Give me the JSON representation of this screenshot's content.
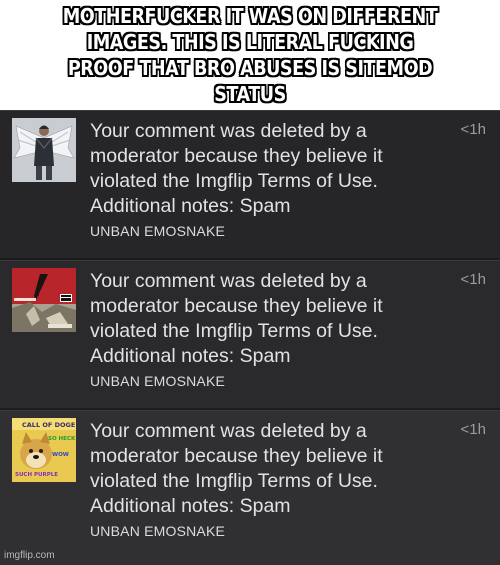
{
  "caption": "MOTHERFUCKER IT WAS ON DIFFERENT\nIMAGES. THIS IS LITERAL FUCKING\nPROOF THAT BRO ABUSES IS SITEMOD STATUS",
  "notifications": [
    {
      "message": "Your comment was deleted by a moderator because they believe it violated the Imgflip Terms of Use. Additional notes: Spam",
      "time": "<1h",
      "action": "UNBAN EMOSNAKE",
      "thumbnail": "winged-figure-image"
    },
    {
      "message": "Your comment was deleted by a moderator because they believe it violated the Imgflip Terms of Use. Additional notes: Spam",
      "time": "<1h",
      "action": "UNBAN EMOSNAKE",
      "thumbnail": "red-album-cover-image"
    },
    {
      "message": "Your comment was deleted by a moderator because they believe it violated the Imgflip Terms of Use. Additional notes: Spam",
      "time": "<1h",
      "action": "UNBAN EMOSNAKE",
      "thumbnail": "doge-meme-image",
      "thumbnail_text": [
        "CALL OF DOGE",
        "SO HECK",
        "WOW",
        "SUCH PURPLE"
      ]
    }
  ],
  "watermark": "imgflip.com"
}
